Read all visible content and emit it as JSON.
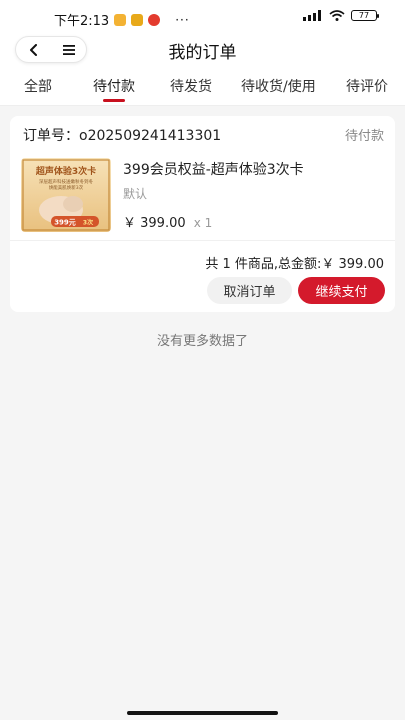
{
  "status_bar": {
    "time": "下午2:13",
    "dots": "···",
    "battery": "77"
  },
  "header": {
    "title": "我的订单"
  },
  "tabs": [
    {
      "label": "全部"
    },
    {
      "label": "待付款"
    },
    {
      "label": "待发货"
    },
    {
      "label": "待收货/使用"
    },
    {
      "label": "待评价"
    }
  ],
  "active_tab": "待付款",
  "order": {
    "number": "订单号：o202509241413301",
    "status": "待付款",
    "product": {
      "title": "399会员权益-超声体验3次卡",
      "spec": "默认",
      "price": "￥ 399.00",
      "qty": "x 1",
      "thumb_title": "超声体验3次卡",
      "thumb_sub1": "深层超声科技送嫩秋冬到冬",
      "thumb_sub2": "焕能美肌焕新3次",
      "thumb_badge": "399元",
      "thumb_badge2": "3次"
    },
    "total": "共 1 件商品,总金额:￥ 399.00",
    "cancel_label": "取消订单",
    "pay_label": "继续支付"
  },
  "footer_text": "没有更多数据了",
  "colors": {
    "accent": "#d41a2c",
    "indicator": "#c8101e",
    "background": "#f5f5f5"
  }
}
